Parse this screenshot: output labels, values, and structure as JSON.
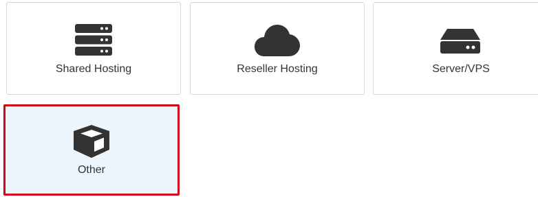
{
  "product_types": [
    {
      "label": "Shared Hosting",
      "icon": "server-stack-icon",
      "selected": false
    },
    {
      "label": "Reseller Hosting",
      "icon": "cloud-icon",
      "selected": false
    },
    {
      "label": "Server/VPS",
      "icon": "hard-drive-icon",
      "selected": false
    },
    {
      "label": "Other",
      "icon": "cube-icon",
      "selected": true
    }
  ],
  "colors": {
    "icon": "#333333",
    "selected_border": "#cc0a13",
    "selected_background": "#eef6fd",
    "card_border": "#d6d6d6"
  }
}
